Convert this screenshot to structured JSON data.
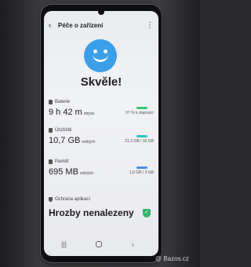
{
  "header": {
    "title": "Péče o zařízení"
  },
  "status": {
    "text": "Skvěle!"
  },
  "battery": {
    "label": "Baterie",
    "value": "9 h 42 m",
    "unit": "zbývá",
    "detail": "97 % k dispozici",
    "bar_color": "#3cc47a"
  },
  "storage": {
    "label": "Úložiště",
    "value": "10,7 GB",
    "unit": "volných",
    "detail": "21,3 GB / 32 GB",
    "bar_color": "#35c3c0"
  },
  "memory": {
    "label": "Paměť",
    "value": "695 MB",
    "unit": "volných",
    "detail": "1,9 GB / 3 GB",
    "bar_color": "#4a8fe6"
  },
  "protection": {
    "label": "Ochrana aplikací",
    "status": "Hrozby nenalezeny"
  },
  "icons": {
    "back": "arrow-left-icon",
    "more": "more-vertical-icon",
    "smiley": "smiley-face-icon",
    "shield_check": "shield-check-icon"
  },
  "watermark": {
    "text": "@ Bazos.cz"
  }
}
